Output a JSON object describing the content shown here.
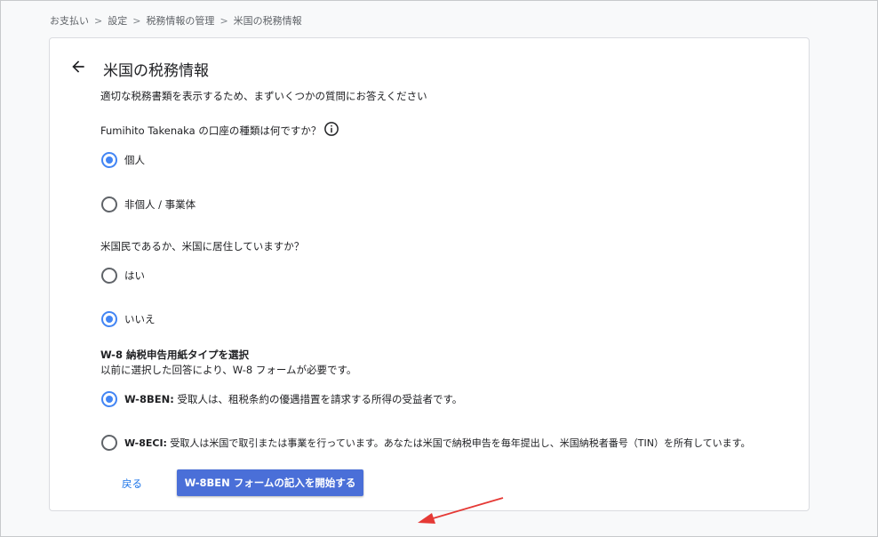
{
  "breadcrumb": {
    "items": [
      "お支払い",
      "設定",
      "税務情報の管理",
      "米国の税務情報"
    ],
    "separator": ">"
  },
  "page": {
    "title": "米国の税務情報",
    "subtitle": "適切な税務書類を表示するため、まずいくつかの質問にお答えください"
  },
  "q1": {
    "question": "Fumihito Takenaka の口座の種類は何ですか？",
    "info_icon": "info-icon",
    "options": [
      {
        "label": "個人",
        "checked": true
      },
      {
        "label": "非個人 / 事業体",
        "checked": false
      }
    ]
  },
  "q2": {
    "question": "米国民であるか、米国に居住していますか？",
    "options": [
      {
        "label": "はい",
        "checked": false
      },
      {
        "label": "いいえ",
        "checked": true
      }
    ]
  },
  "w8": {
    "heading": "W-8 納税申告用紙タイプを選択",
    "description": "以前に選択した回答により、W-8 フォームが必要です。",
    "options": [
      {
        "name": "W-8BEN:",
        "text": " 受取人は、租税条約の優遇措置を請求する所得の受益者です。",
        "checked": true
      },
      {
        "name": "W-8ECI:",
        "text": " 受取人は米国で取引または事業を行っています。あなたは米国で納税申告を毎年提出し、米国納税者番号（TIN）を所有しています。",
        "checked": false
      }
    ]
  },
  "actions": {
    "back_label": "戻る",
    "start_label": "W-8BEN フォームの記入を開始する"
  },
  "colors": {
    "accent": "#4285f4",
    "button": "#4a6fd8",
    "link": "#1a73e8",
    "annotation": "#e53935"
  }
}
